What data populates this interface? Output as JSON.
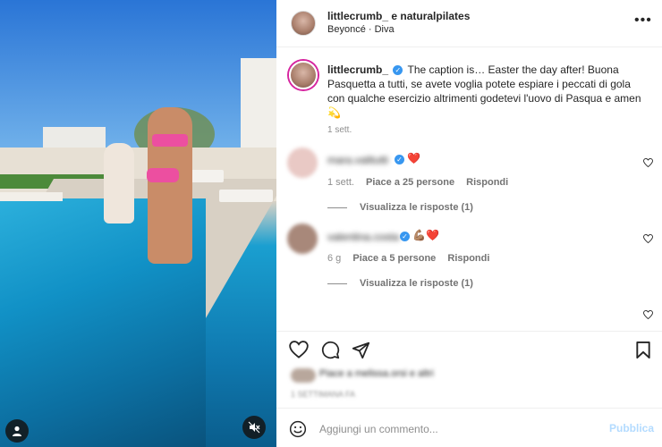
{
  "post": {
    "header": {
      "username": "littlecrumb_ e naturalpilates",
      "audio": "Beyoncé · Diva",
      "more_icon": "more-horizontal-icon"
    },
    "caption": {
      "username": "littlecrumb_",
      "verified_icon": "verified-badge-icon",
      "text": "The caption is… Easter the day after! Buona Pasquetta a tutti, se avete voglia potete espiare i peccati di gola con qualche esercizio altrimenti godetevi l'uovo di Pasqua e amen 💫",
      "time": "1 sett."
    },
    "comments": [
      {
        "username": "mara.valitutti",
        "emoji": "❤️",
        "time": "1 sett.",
        "likes": "Piace a 25 persone",
        "reply": "Rispondi",
        "view_replies": "Visualizza le risposte (1)"
      },
      {
        "username": "valentina.costa",
        "emoji": "💪🏽❤️",
        "time": "6 g",
        "likes": "Piace a 5 persone",
        "reply": "Rispondi",
        "view_replies": "Visualizza le risposte (1)"
      }
    ],
    "likes_text": "Piace a melissa.orsi e altri",
    "date_text": "1 SETTIMANA FA",
    "add_comment": {
      "placeholder": "Aggiungi un commento...",
      "publish": "Pubblica"
    }
  },
  "colors": {
    "link_blue_disabled": "#b3dbff",
    "verified": "#3897f0",
    "heart_red": "#ed4956",
    "muted_text": "#8e8e8e"
  }
}
